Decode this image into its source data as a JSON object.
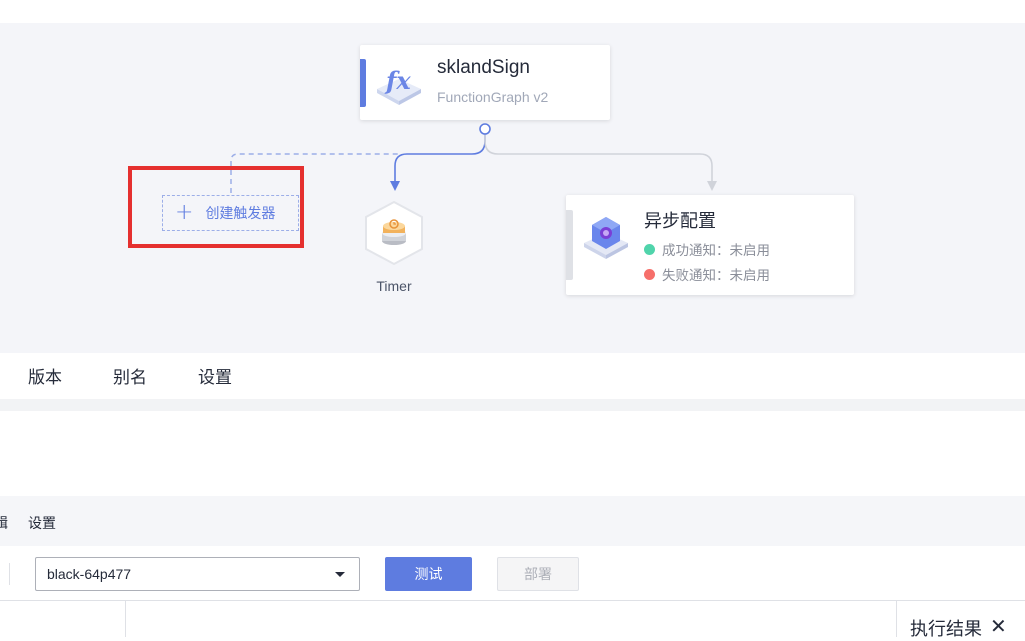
{
  "function_node": {
    "name": "sklandSign",
    "runtime": "FunctionGraph v2",
    "icon": "fx-icon"
  },
  "trigger": {
    "create_label": "创建触发器",
    "existing": [
      {
        "name": "Timer",
        "icon": "timer-icon"
      }
    ]
  },
  "async_config": {
    "title": "异步配置",
    "success_notify": "成功通知：未启用",
    "failure_notify": "失败通知：未启用",
    "success_color": "#50d4ab",
    "failure_color": "#f66f6a"
  },
  "tabs": [
    "版本",
    "别名",
    "设置"
  ],
  "sub_tabs": {
    "partial": "辑",
    "settings": "设置"
  },
  "toolbar": {
    "event_selected": "black-64p477",
    "test_label": "测试",
    "deploy_label": "部署"
  },
  "result_panel": {
    "title": "执行结果",
    "close": "✕"
  },
  "colors": {
    "accent": "#5e7ce0",
    "highlight": "#e5302f",
    "canvas_bg": "#f4f5f9"
  }
}
